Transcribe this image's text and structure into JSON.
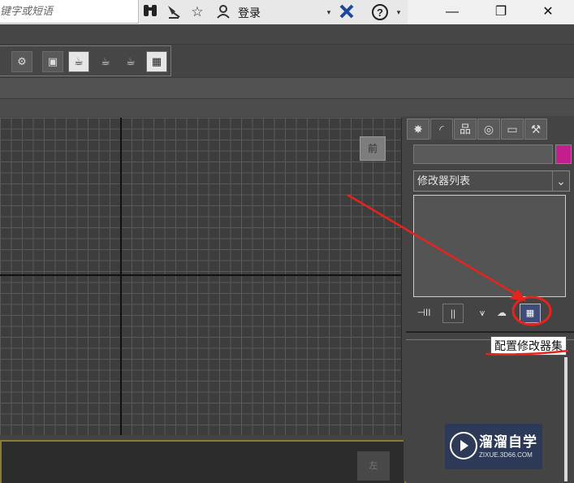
{
  "title_bar": {
    "search_placeholder": "键字或短语",
    "login_label": "登录",
    "icons": [
      "binoculars-icon",
      "satellite-icon",
      "star-icon",
      "user-icon",
      "dropdown-icon",
      "x-exchange-icon",
      "help-icon",
      "dropdown-icon"
    ],
    "window_controls": {
      "minimize": "—",
      "restore": "❐",
      "close": "✕"
    }
  },
  "main_toolbar": {
    "icons": [
      "render-setup-icon",
      "rendered-frame-icon",
      "teapot-render-icon",
      "teapot-render-alt-icon",
      "teapot-active-icon",
      "render-frame-window-icon"
    ]
  },
  "viewport": {
    "viewcube_label": "前",
    "bottom_viewcube_label": "左"
  },
  "command_panel": {
    "tabs": [
      {
        "name": "create",
        "glyph": "✸",
        "active": false
      },
      {
        "name": "modify",
        "glyph": "◜",
        "active": true
      },
      {
        "name": "hierarchy",
        "glyph": "品",
        "active": false
      },
      {
        "name": "motion",
        "glyph": "◎",
        "active": false
      },
      {
        "name": "display",
        "glyph": "▭",
        "active": false
      },
      {
        "name": "utilities",
        "glyph": "⚒",
        "active": false
      }
    ],
    "object_color": "#c21e8d",
    "modifier_list_label": "修改器列表",
    "stack_controls": [
      "pin-stack-icon",
      "show-end-result-icon",
      "make-unique-icon",
      "remove-modifier-icon",
      "configure-modifier-sets-icon"
    ],
    "tooltip": "配置修改器集"
  },
  "watermark": {
    "title": "溜溜自学",
    "url": "ZIXUE.3D66.COM"
  },
  "annotation_color": "#e8231b"
}
